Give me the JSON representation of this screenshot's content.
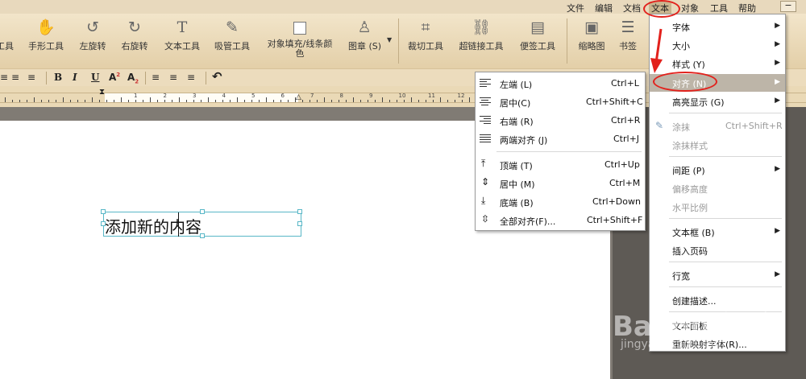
{
  "menubar": {
    "items": [
      "文件",
      "编辑",
      "文档",
      "文本",
      "对象",
      "工具",
      "帮助"
    ],
    "minimize": "−"
  },
  "toolbar": {
    "tools": [
      {
        "label": "工具",
        "icon": "tool-icon"
      },
      {
        "label": "手形工具",
        "icon": "hand-icon"
      },
      {
        "label": "左旋转",
        "icon": "rotate-left-icon"
      },
      {
        "label": "右旋转",
        "icon": "rotate-right-icon"
      },
      {
        "label": "文本工具",
        "icon": "text-tool-icon"
      },
      {
        "label": "吸管工具",
        "icon": "eyedropper-icon"
      },
      {
        "label": "对象填充/线条颜",
        "label2": "色",
        "icon": "fill-box-icon"
      },
      {
        "label": "图章 (S)",
        "icon": "stamp-icon"
      },
      {
        "label": "裁切工具",
        "icon": "crop-icon"
      },
      {
        "label": "超链接工具",
        "icon": "link-icon"
      },
      {
        "label": "便签工具",
        "icon": "note-icon"
      },
      {
        "label": "缩略图",
        "icon": "thumbnail-icon"
      },
      {
        "label": "书签",
        "icon": "bookmark-list-icon"
      }
    ]
  },
  "formatbar": {
    "bold": "B",
    "italic": "I",
    "underline": "U",
    "superscript": "A",
    "superscript_mark": "2",
    "subscript": "A",
    "subscript_mark": "2"
  },
  "ruler": {
    "labels": [
      "1",
      "2",
      "3",
      "4",
      "5",
      "6",
      "7",
      "8",
      "9",
      "10",
      "11",
      "12"
    ]
  },
  "document": {
    "text_before_caret": "添加新的",
    "text_after_caret": "内容"
  },
  "text_menu": {
    "items": [
      {
        "label": "字体",
        "submenu": true
      },
      {
        "label": "大小",
        "submenu": true
      },
      {
        "label": "样式 (Y)",
        "submenu": true
      },
      {
        "label": "对齐 (N)",
        "submenu": true,
        "highlighted": true
      },
      {
        "label": "高亮显示 (G)",
        "submenu": true
      },
      {
        "label": "涂抹",
        "shortcut": "Ctrl+Shift+R",
        "disabled": true
      },
      {
        "label": "涂抹样式",
        "disabled": true
      },
      {
        "label": "间距 (P)",
        "submenu": true
      },
      {
        "label": "偏移高度",
        "disabled": true
      },
      {
        "label": "水平比例",
        "disabled": true
      },
      {
        "label": "文本框 (B)",
        "submenu": true
      },
      {
        "label": "插入页码"
      },
      {
        "label": "行宽",
        "submenu": true
      },
      {
        "label": "创建描述..."
      },
      {
        "label": "文本面板"
      },
      {
        "label": "重新映射字体(R)..."
      }
    ]
  },
  "align_menu": {
    "items": [
      {
        "label": "左端 (L)",
        "shortcut": "Ctrl+L",
        "icon": "align-left-icon"
      },
      {
        "label": "居中(C)",
        "shortcut": "Ctrl+Shift+C",
        "icon": "align-center-icon"
      },
      {
        "label": "右端 (R)",
        "shortcut": "Ctrl+R",
        "icon": "align-right-icon"
      },
      {
        "label": "两端对齐 (J)",
        "shortcut": "Ctrl+J",
        "icon": "align-justify-icon"
      },
      {
        "label": "顶端 (T)",
        "shortcut": "Ctrl+Up",
        "icon": "align-top-icon"
      },
      {
        "label": "居中 (M)",
        "shortcut": "Ctrl+M",
        "icon": "align-middle-icon"
      },
      {
        "label": "底端 (B)",
        "shortcut": "Ctrl+Down",
        "icon": "align-bottom-icon"
      },
      {
        "label": "全部对齐(F)...",
        "shortcut": "Ctrl+Shift+F",
        "icon": "align-all-icon"
      }
    ]
  },
  "watermark": {
    "logo": "Bai du 经验",
    "url": "jingyan.baidu.com"
  },
  "colors": {
    "highlight_ring": "#e2211c",
    "selection_box": "#58b7c7",
    "toolbar": "#e8d9bd"
  }
}
